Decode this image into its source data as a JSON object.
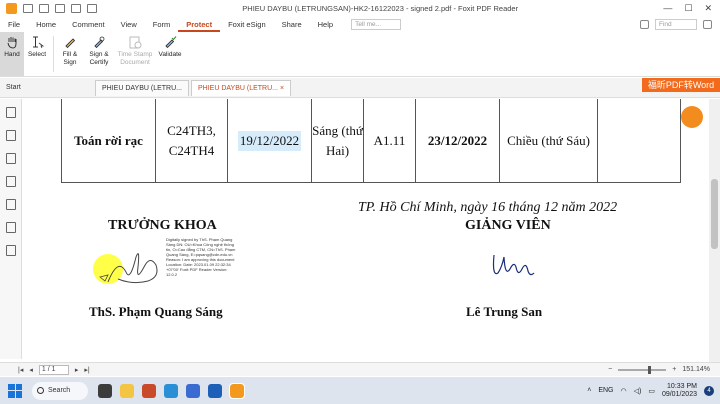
{
  "window": {
    "title": "PHIEU DAYBU (LETRUNGSAN)-HK2-16122023 - signed 2.pdf - Foxit PDF Reader"
  },
  "menu": {
    "items": [
      "File",
      "Home",
      "Comment",
      "View",
      "Form",
      "Protect",
      "Foxit eSign",
      "Share",
      "Help"
    ],
    "active": "Protect",
    "tell_me": "Tell me...",
    "find": "Find"
  },
  "ribbon": {
    "hand": "Hand",
    "select": "Select",
    "fill_sign_1": "Fill &",
    "fill_sign_2": "Sign",
    "sign_certify_1": "Sign &",
    "sign_certify_2": "Certify",
    "timestamp_1": "Time Stamp",
    "timestamp_2": "Document",
    "validate": "Validate"
  },
  "tabs": {
    "start": "Start",
    "tab1": "PHIEU DAYBU (LETRU...",
    "tab2": "PHIEU DAYBU (LETRU...",
    "close": "×",
    "promo": "福昕PDF转Word"
  },
  "document": {
    "row": {
      "subject": "Toán rời rạc",
      "classes": "C24TH3, C24TH4",
      "date1": "19/12/2022",
      "session1": "Sáng (thứ Hai)",
      "room": "A1.11",
      "date2": "23/12/2022",
      "session2": "Chiều (thứ Sáu)"
    },
    "date_city": "TP. Hồ Chí Minh, ngày 16 tháng 12 năm 2022",
    "dean_title": "TRƯỞNG KHOA",
    "lecturer_title": "GIẢNG VIÊN",
    "dean_name": "ThS. Phạm Quang Sáng",
    "lecturer_name": "Lê Trung San",
    "digital_signature_text": "Digitally signed by ThS. Phạm Quang Sáng DN: OU=Khoa Công nghệ thông tin, O=Cao đẳng CTM, CN=ThS. Phạm Quang Sáng, E=pqsang@cdn.edu.vn Reason: I am approving this document Location: Date: 2023.01.09 22:32:34 +07'00' Foxit PDF Reader Version: 12.0.2"
  },
  "status": {
    "page": "1 / 1",
    "zoom": "151.14%",
    "zoom_fraction": 0.62
  },
  "taskbar": {
    "search": "Search",
    "lang": "ENG",
    "time": "10:33 PM",
    "date": "09/01/2023",
    "notifications": "4"
  },
  "colors": {
    "accent": "#c8481d",
    "promo": "#f26b1d",
    "highlight": "#d6ecfb",
    "taskbar": "#dde4ee"
  }
}
